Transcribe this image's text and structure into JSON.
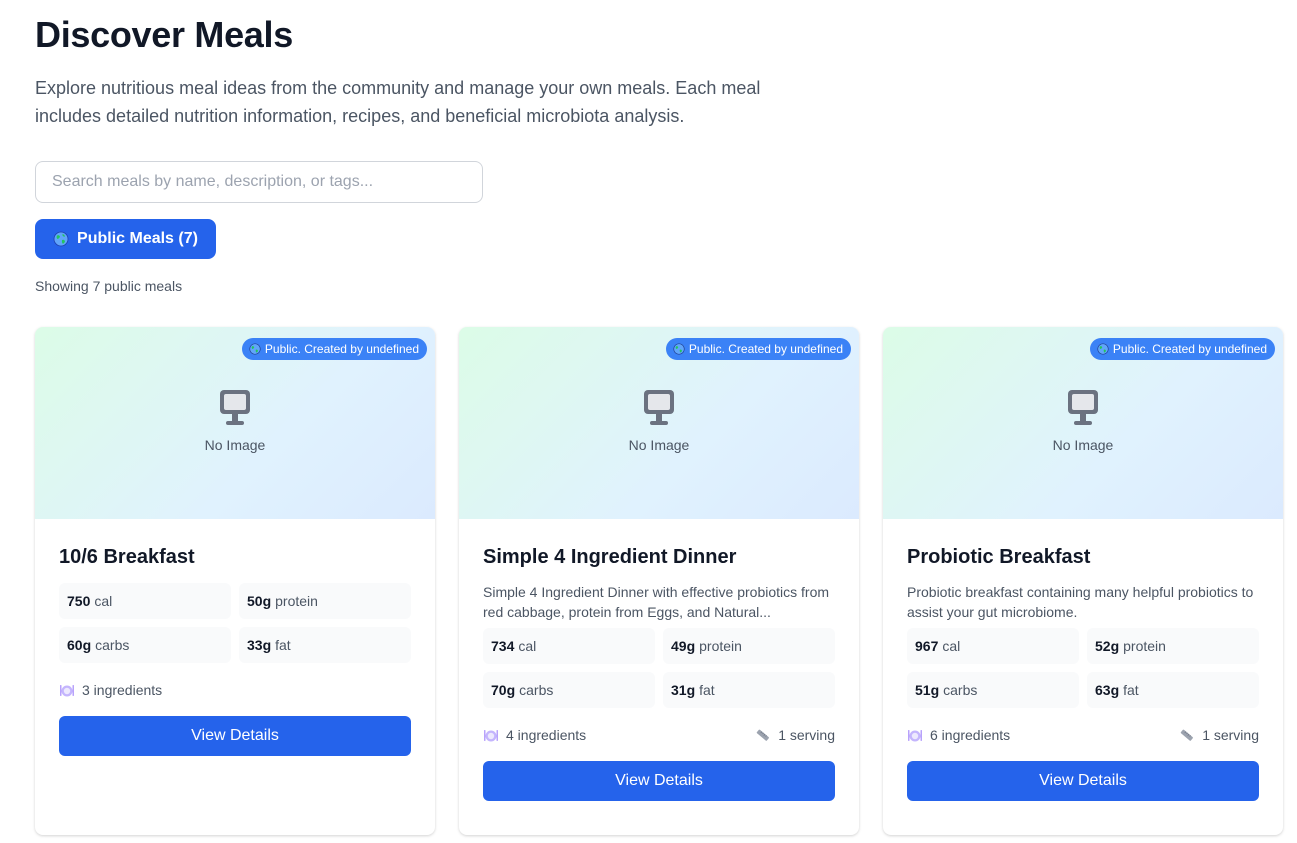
{
  "header": {
    "title": "Discover Meals",
    "intro": "Explore nutritious meal ideas from the community and manage your own meals. Each meal includes detailed nutrition information, recipes, and beneficial microbiota analysis."
  },
  "search": {
    "placeholder": "Search meals by name, description, or tags...",
    "value": ""
  },
  "filter": {
    "label": "Public Meals (7)",
    "icon": "globe-icon"
  },
  "results": {
    "count_text": "Showing 7 public meals"
  },
  "colors": {
    "primary": "#2563eb",
    "badge": "#3b82f6",
    "text_muted": "#4b5563"
  },
  "meals": [
    {
      "badge": "Public. Created by undefined",
      "no_image": "No Image",
      "title": "10/6 Breakfast",
      "description": "",
      "cal": "750",
      "cal_unit": "cal",
      "protein": "50g",
      "protein_unit": "protein",
      "carbs": "60g",
      "carbs_unit": "carbs",
      "fat": "33g",
      "fat_unit": "fat",
      "ingredients": "3 ingredients",
      "servings": "",
      "button": "View Details"
    },
    {
      "badge": "Public. Created by undefined",
      "no_image": "No Image",
      "title": "Simple 4 Ingredient Dinner",
      "description": "Simple 4 Ingredient Dinner with effective probiotics from red cabbage, protein from Eggs, and Natural...",
      "cal": "734",
      "cal_unit": "cal",
      "protein": "49g",
      "protein_unit": "protein",
      "carbs": "70g",
      "carbs_unit": "carbs",
      "fat": "31g",
      "fat_unit": "fat",
      "ingredients": "4 ingredients",
      "servings": "1 serving",
      "button": "View Details"
    },
    {
      "badge": "Public. Created by undefined",
      "no_image": "No Image",
      "title": "Probiotic Breakfast",
      "description": "Probiotic breakfast containing many helpful probiotics to assist your gut microbiome.",
      "cal": "967",
      "cal_unit": "cal",
      "protein": "52g",
      "protein_unit": "protein",
      "carbs": "51g",
      "carbs_unit": "carbs",
      "fat": "63g",
      "fat_unit": "fat",
      "ingredients": "6 ingredients",
      "servings": "1 serving",
      "button": "View Details"
    }
  ]
}
